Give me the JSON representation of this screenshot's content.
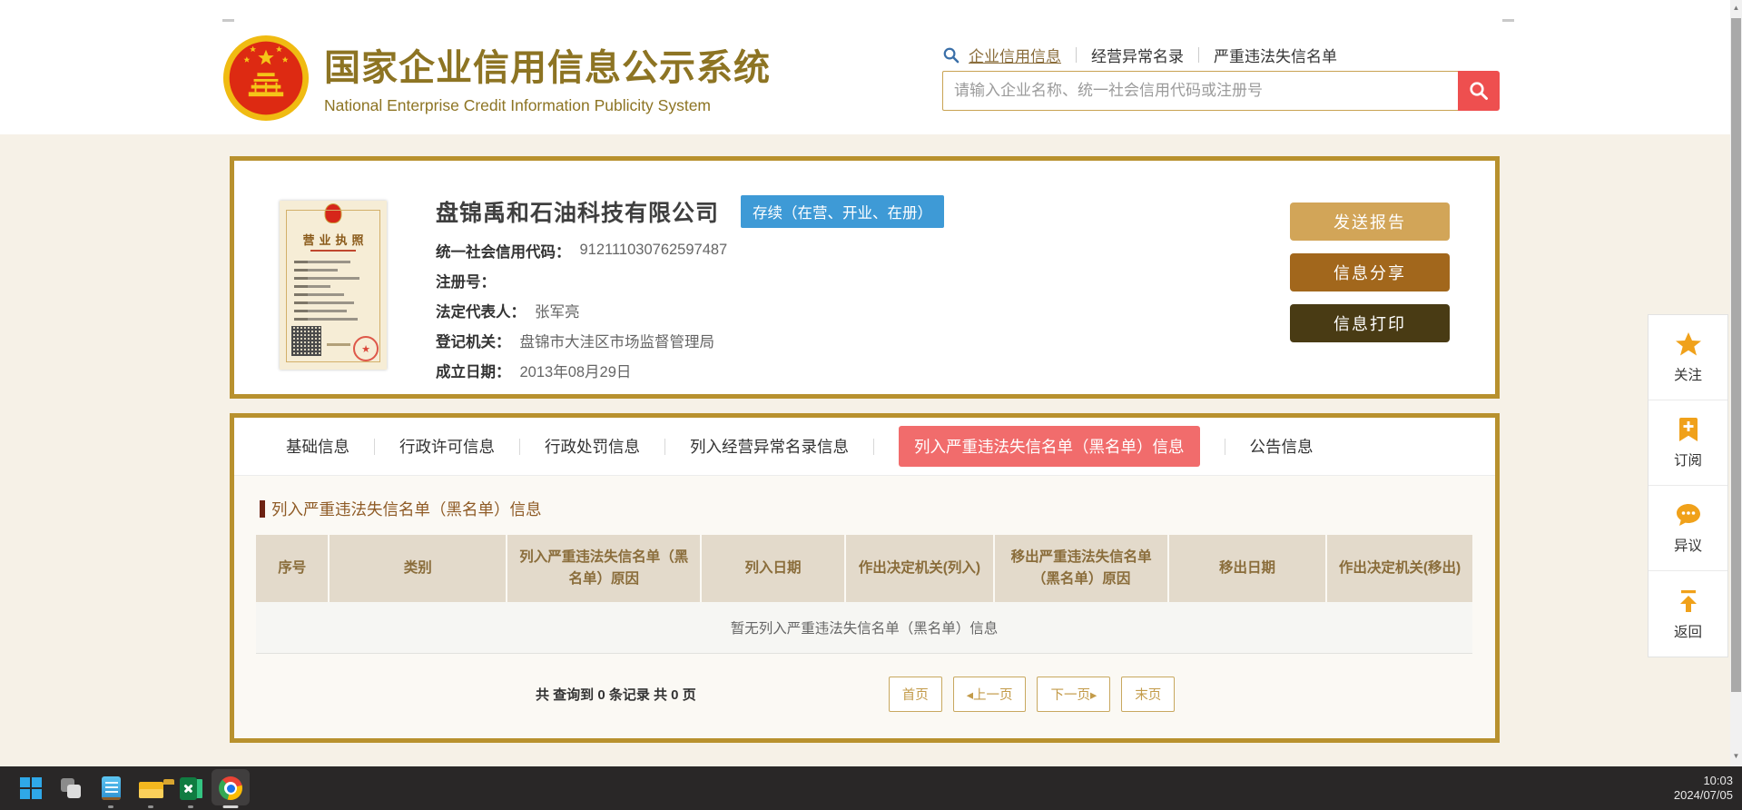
{
  "header": {
    "site_title": "国家企业信用信息公示系统",
    "site_subtitle": "National Enterprise Credit Information Publicity System",
    "nav": [
      {
        "label": "企业信用信息",
        "active": true
      },
      {
        "label": "经营异常名录",
        "active": false
      },
      {
        "label": "严重违法失信名单",
        "active": false
      }
    ],
    "search_placeholder": "请输入企业名称、统一社会信用代码或注册号"
  },
  "company": {
    "name": "盘锦禹和石油科技有限公司",
    "status_badge": "存续（在营、开业、在册）",
    "license_title": "营业执照",
    "fields": [
      {
        "label": "统一社会信用代码：",
        "value": "912111030762597487"
      },
      {
        "label": "注册号：",
        "value": ""
      },
      {
        "label": "法定代表人：",
        "value": "张军亮"
      },
      {
        "label": "登记机关：",
        "value": "盘锦市大洼区市场监督管理局"
      },
      {
        "label": "成立日期：",
        "value": "2013年08月29日"
      }
    ],
    "actions": [
      {
        "label": "发送报告",
        "color": "#d2a558"
      },
      {
        "label": "信息分享",
        "color": "#a2671c"
      },
      {
        "label": "信息打印",
        "color": "#493b14"
      }
    ]
  },
  "tabs": [
    {
      "label": "基础信息",
      "active": false
    },
    {
      "label": "行政许可信息",
      "active": false
    },
    {
      "label": "行政处罚信息",
      "active": false
    },
    {
      "label": "列入经营异常名录信息",
      "active": false
    },
    {
      "label": "列入严重违法失信名单（黑名单）信息",
      "active": true
    },
    {
      "label": "公告信息",
      "active": false
    }
  ],
  "section": {
    "title": "列入严重违法失信名单（黑名单）信息",
    "table": {
      "headers": [
        "序号",
        "类别",
        "列入严重违法失信名单（黑名单）原因",
        "列入日期",
        "作出决定机关(列入)",
        "移出严重违法失信名单（黑名单）原因",
        "移出日期",
        "作出决定机关(移出)"
      ],
      "empty_message": "暂无列入严重违法失信名单（黑名单）信息"
    },
    "pagination": {
      "summary": "共 查询到 0 条记录 共 0 页",
      "buttons": [
        "首页",
        "◂上一页",
        "下一页▸",
        "末页"
      ]
    }
  },
  "side_toolbar": [
    {
      "label": "关注",
      "icon": "star-icon"
    },
    {
      "label": "订阅",
      "icon": "bookmark-plus-icon"
    },
    {
      "label": "异议",
      "icon": "chat-dots-icon"
    },
    {
      "label": "返回",
      "icon": "back-to-top-icon"
    }
  ],
  "taskbar": {
    "time": "10:03",
    "date": "2024/07/05"
  },
  "colors": {
    "brand_gold": "#8d7423",
    "card_border": "#b8912e",
    "status_blue": "#3e9ad6",
    "search_red": "#ee4f4f",
    "active_tab_red": "#f16c6c",
    "table_header_bg": "#e3dacb",
    "table_header_text": "#8a6d3b",
    "sidebar_icon_orange": "#f0a11a"
  }
}
